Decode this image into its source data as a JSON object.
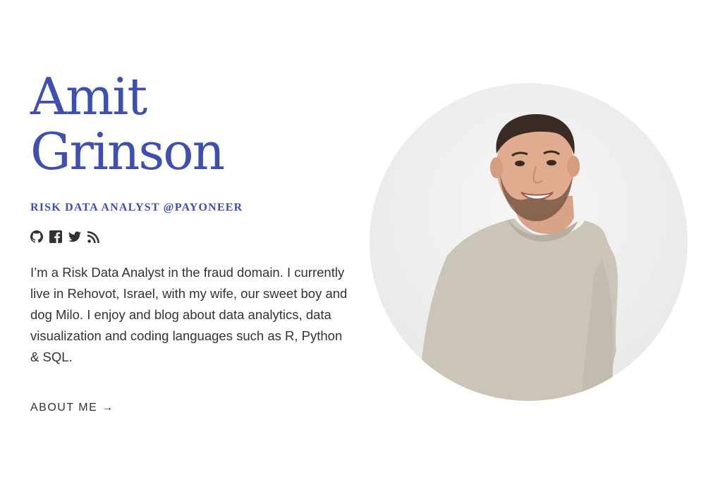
{
  "profile": {
    "first_name": "Amit",
    "last_name": "Grinson",
    "subtitle": "RISK DATA ANALYST @PAYONEER",
    "bio": "I’m a Risk Data Analyst in the fraud domain. I currently live in Rehovot, Israel, with my wife, our sweet boy and dog Milo. I enjoy and blog about data analytics, data visualization and coding languages such as R, Python & SQL.",
    "about_link": "ABOUT ME →"
  },
  "socials": [
    {
      "icon": "github-icon"
    },
    {
      "icon": "facebook-icon"
    },
    {
      "icon": "twitter-icon"
    },
    {
      "icon": "rss-icon"
    }
  ],
  "colors": {
    "accent": "#3e4fb0",
    "text": "#333333",
    "background": "#ffffff"
  }
}
